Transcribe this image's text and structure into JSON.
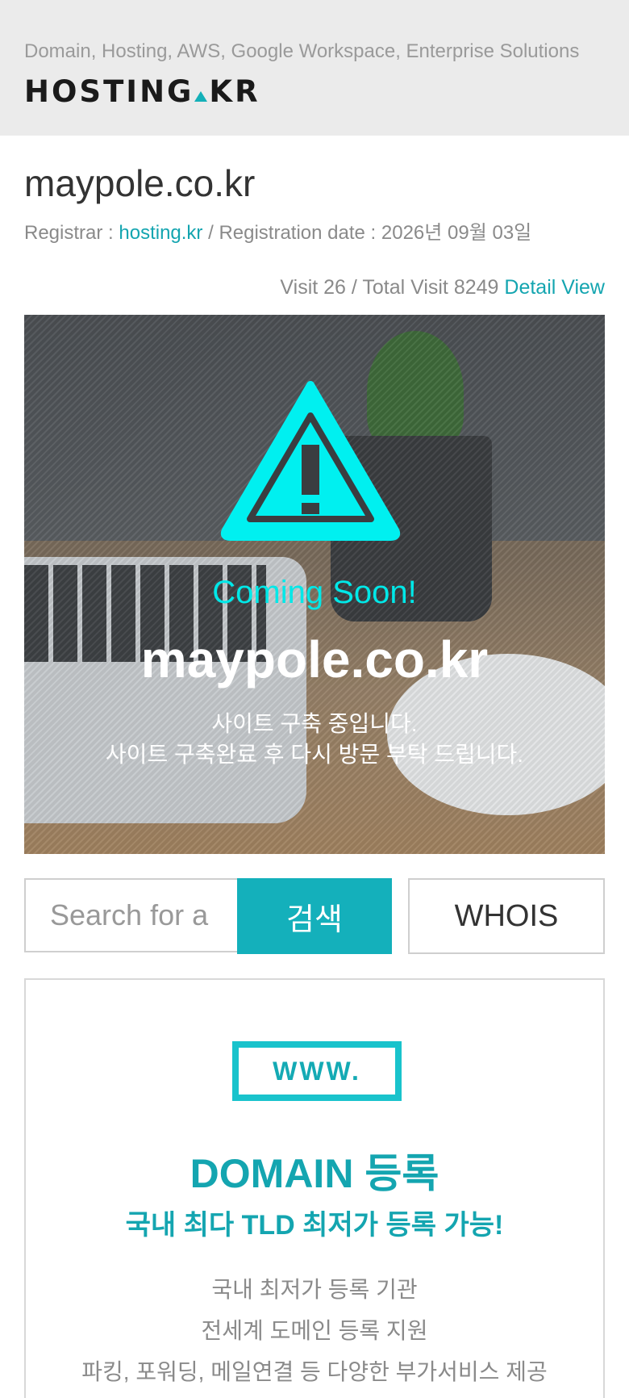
{
  "header": {
    "tagline": "Domain, Hosting, AWS, Google Workspace, Enterprise Solutions",
    "logo_left": "HOSTING",
    "logo_right": "KR"
  },
  "domain": {
    "name": "maypole.co.kr",
    "registrar_label": "Registrar : ",
    "registrar_link": "hosting.kr",
    "registration_label": " / Registration date : ",
    "registration_date": "2026년 09월 03일"
  },
  "visits": {
    "text": "Visit 26 / Total Visit 8249 ",
    "detail_link": "Detail View"
  },
  "hero": {
    "coming_soon": "Coming Soon!",
    "domain": "maypole.co.kr",
    "message_line1": "사이트 구축 중입니다.",
    "message_line2": "사이트 구축완료 후 다시 방문 부탁 드립니다."
  },
  "search": {
    "placeholder": "Search for a",
    "search_label": "검색",
    "whois_label": "WHOIS"
  },
  "domain_card": {
    "badge": "WWW.",
    "title": "DOMAIN 등록",
    "subtitle": "국내 최다 TLD 최저가 등록 가능!",
    "features": [
      "국내 최저가 등록 기관",
      "전세계 도메인 등록 지원",
      "파킹, 포워딩, 메일연결 등 다양한 부가서비스 제공"
    ]
  },
  "colors": {
    "accent": "#14b0bb",
    "warning_icon": "#00f0f0",
    "header_bg": "#ebebeb"
  }
}
